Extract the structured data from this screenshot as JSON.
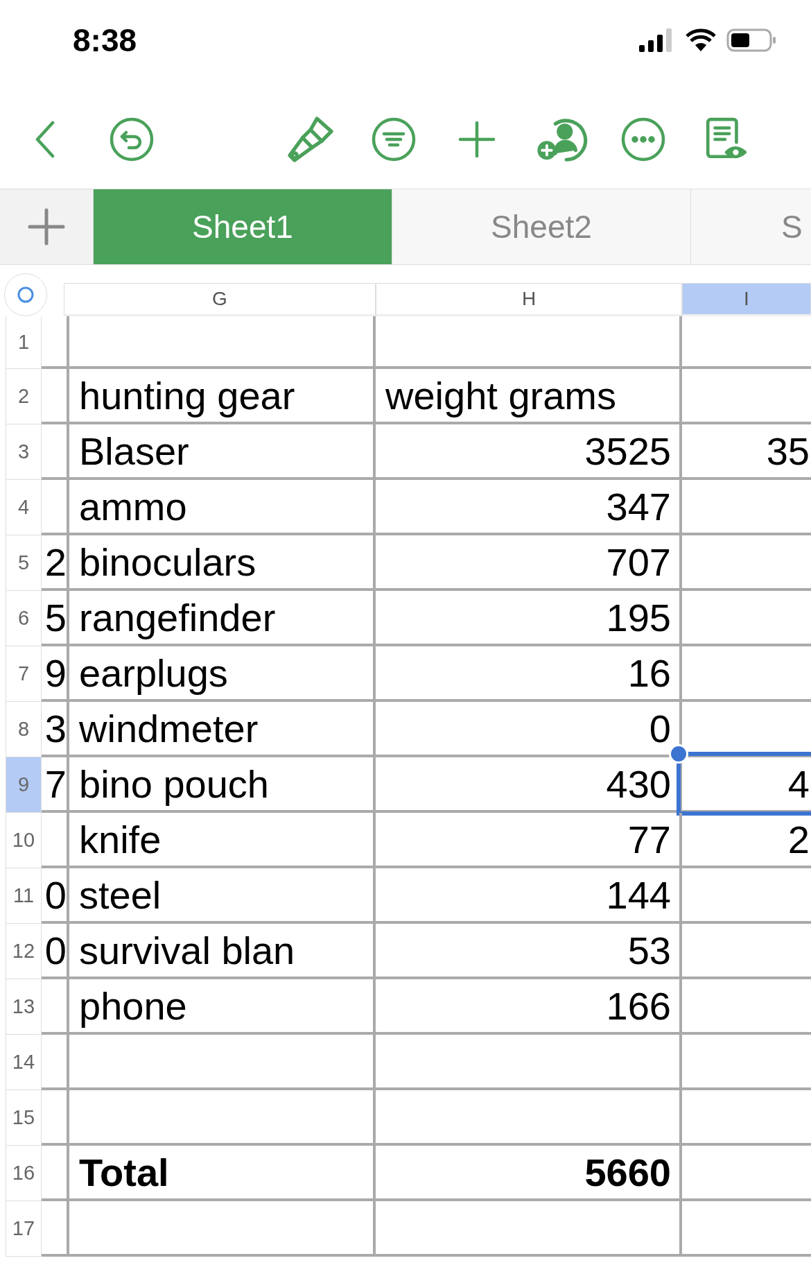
{
  "status_bar": {
    "time": "8:38"
  },
  "sheet_tabs": [
    {
      "label": "Sheet1",
      "selected": true
    },
    {
      "label": "Sheet2",
      "selected": false
    },
    {
      "label": "S",
      "selected": false
    }
  ],
  "columns": [
    {
      "label": "G",
      "selected": false
    },
    {
      "label": "H",
      "selected": false
    },
    {
      "label": "I",
      "selected": true
    }
  ],
  "rows": [
    {
      "number": "1",
      "kind": "blank",
      "selected": false
    },
    {
      "number": "2",
      "kind": "heading",
      "g": "hunting gear",
      "h": "weight grams",
      "selected": false
    },
    {
      "number": "3",
      "kind": "item",
      "g": "Blaser",
      "h": "3525",
      "i": "35",
      "selected": false
    },
    {
      "number": "4",
      "kind": "item",
      "g": "ammo",
      "h": "347",
      "selected": false
    },
    {
      "number": "5",
      "kind": "item",
      "f": "2",
      "g": "binoculars",
      "h": "707",
      "selected": false
    },
    {
      "number": "6",
      "kind": "item",
      "f": "5",
      "g": "rangefinder",
      "h": "195",
      "selected": false
    },
    {
      "number": "7",
      "kind": "item",
      "f": "9",
      "g": "earplugs",
      "h": "16",
      "selected": false
    },
    {
      "number": "8",
      "kind": "item",
      "f": "3",
      "g": "windmeter",
      "h": "0",
      "selected": false
    },
    {
      "number": "9",
      "kind": "item",
      "f": "7",
      "g": "bino pouch",
      "h": "430",
      "i": "4",
      "selected": true
    },
    {
      "number": "10",
      "kind": "item",
      "g": "knife",
      "h": "77",
      "i": "2",
      "selected": false
    },
    {
      "number": "11",
      "kind": "item",
      "f": "0",
      "g": "steel",
      "h": "144",
      "selected": false
    },
    {
      "number": "12",
      "kind": "item",
      "f": "0",
      "g": "survival blan",
      "h": "53",
      "selected": false
    },
    {
      "number": "13",
      "kind": "item",
      "g": "phone",
      "h": "166",
      "selected": false
    },
    {
      "number": "14",
      "kind": "blank",
      "selected": false
    },
    {
      "number": "15",
      "kind": "blank",
      "selected": false
    },
    {
      "number": "16",
      "kind": "total",
      "g": "Total",
      "h": "5660",
      "selected": false
    },
    {
      "number": "17",
      "kind": "blank",
      "selected": false
    }
  ]
}
